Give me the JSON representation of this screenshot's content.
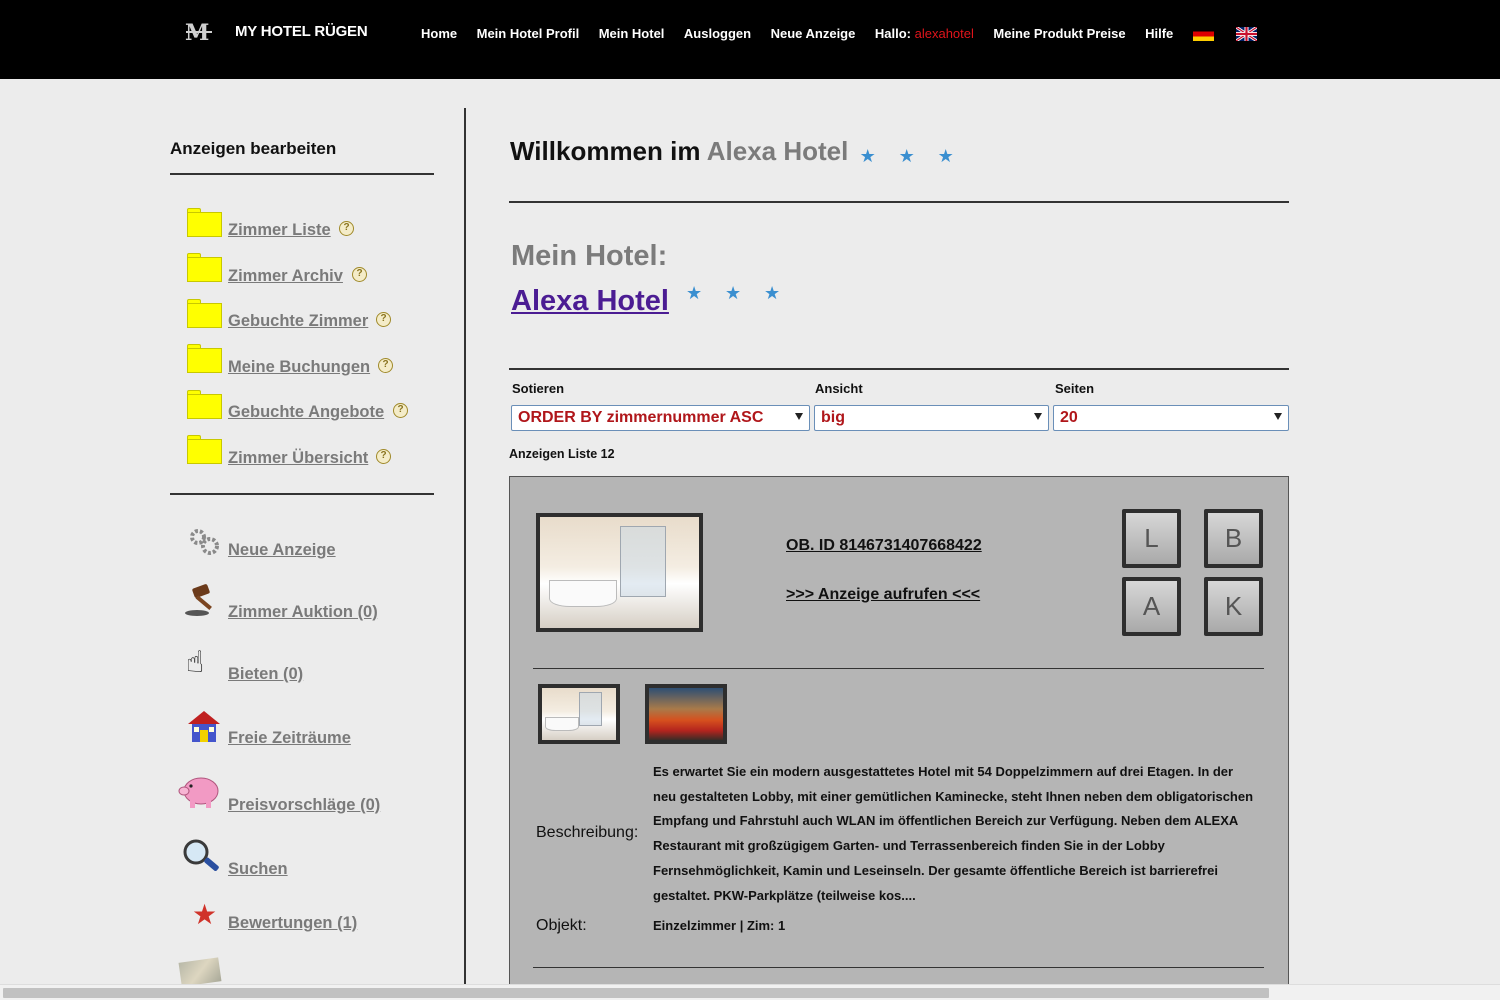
{
  "header": {
    "brand": "MY HOTEL RÜGEN",
    "nav": {
      "home": "Home",
      "profile": "Mein Hotel Profil",
      "hotel": "Mein Hotel",
      "logout": "Ausloggen",
      "new_ad": "Neue Anzeige",
      "greeting": "Hallo:",
      "user": "alexahotel",
      "prices": "Meine Produkt Preise",
      "help": "Hilfe"
    },
    "flags": [
      "flag-de-icon",
      "flag-uk-icon"
    ]
  },
  "sidebar": {
    "title": "Anzeigen bearbeiten",
    "folder_items": [
      {
        "label": "Zimmer Liste"
      },
      {
        "label": "Zimmer Archiv"
      },
      {
        "label": "Gebuchte Zimmer"
      },
      {
        "label": "Meine Buchungen"
      },
      {
        "label": "Gebuchte Angebote"
      },
      {
        "label": "Zimmer Übersicht"
      }
    ],
    "action_items": [
      {
        "label": "Neue Anzeige",
        "icon": "gears-icon"
      },
      {
        "label": "Zimmer Auktion (0)",
        "icon": "gavel-icon"
      },
      {
        "label": "Bieten (0)",
        "icon": "hand-icon"
      },
      {
        "label": "Freie Zeiträume",
        "icon": "house-icon"
      },
      {
        "label": "Preisvorschläge (0)",
        "icon": "piggy-bank-icon"
      },
      {
        "label": "Suchen",
        "icon": "magnifier-icon"
      },
      {
        "label": "Bewertungen (1)",
        "icon": "star-icon"
      }
    ]
  },
  "main": {
    "welcome_prefix": "Willkommen im",
    "welcome_hotel": "Alexa Hotel",
    "star_count": 3,
    "mein_hotel_label": "Mein Hotel:",
    "hotel_name": "Alexa Hotel",
    "controls": {
      "sort_label": "Sotieren",
      "sort_value": "ORDER BY zimmernummer ASC",
      "view_label": "Ansicht",
      "view_value": "big",
      "pages_label": "Seiten",
      "pages_value": "20"
    },
    "list_count": "Anzeigen Liste 12",
    "card": {
      "ob_id": "OB. ID 8146731407668422",
      "open_link": ">>> Anzeige aufrufen <<<",
      "buttons": [
        "L",
        "B",
        "A",
        "K"
      ],
      "description_label": "Beschreibung:",
      "description": "Es erwartet Sie ein modern ausgestattetes Hotel mit 54 Doppelzimmern auf drei Etagen. In der neu gestalteten Lobby, mit einer gemütlichen Kaminecke, steht Ihnen neben dem obligatorischen Empfang und Fahrstuhl auch WLAN im öffentlichen Bereich zur Verfügung. Neben dem ALEXA Restaurant mit großzügigem Garten- und Terrassenbereich finden Sie in der Lobby Fernsehmöglichkeit, Kamin und Leseinseln. Der gesamte öffentliche Bereich ist barrierefrei gestaltet. PKW-Parkplätze (teilweise kos....",
      "object_label": "Objekt:",
      "object_value": "Einzelzimmer | Zim: 1"
    }
  },
  "colors": {
    "topbar": "#000000",
    "user_highlight": "#e0141b",
    "star": "#3a8fd0",
    "hotel_link": "#4b1c93",
    "select_text": "#b0161a",
    "folder": "#ffff00"
  }
}
